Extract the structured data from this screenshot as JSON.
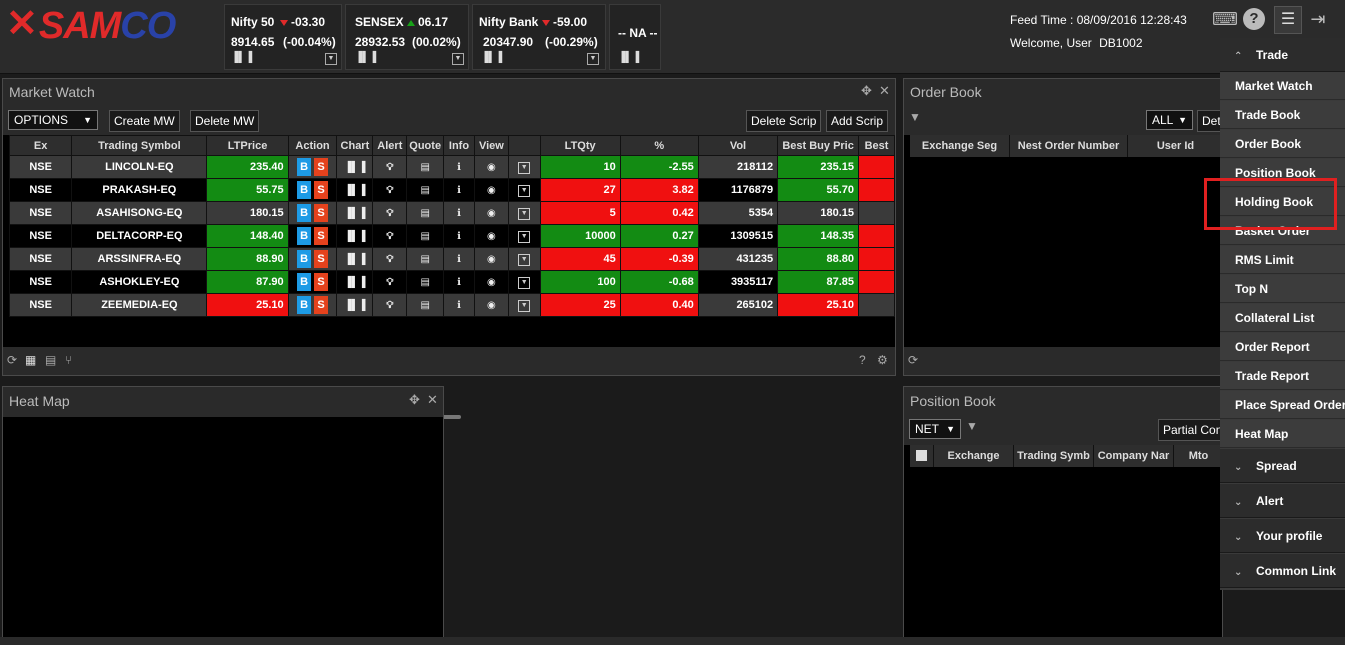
{
  "logo": {
    "mark": "✕",
    "part1": "SAM",
    "part2": "CO"
  },
  "indices": [
    {
      "name": "Nifty 50",
      "change": "-03.30",
      "direction": "down",
      "value": "8914.65",
      "percent": "(-00.04%)"
    },
    {
      "name": "SENSEX",
      "change": "06.17",
      "direction": "up",
      "value": "28932.53",
      "percent": "(00.02%)"
    },
    {
      "name": "Nifty Bank",
      "change": "-59.00",
      "direction": "down",
      "value": "20347.90",
      "percent": "(-00.29%)"
    },
    {
      "name": "-- NA --"
    }
  ],
  "header": {
    "feed_label": "Feed Time :",
    "feed_time": "08/09/2016 12:28:43",
    "welcome_label": "Welcome, User",
    "user_id": "DB1002"
  },
  "market_watch": {
    "title": "Market Watch",
    "options_select": "OPTIONS",
    "create_label": "Create MW",
    "delete_label": "Delete MW",
    "delete_scrip_label": "Delete Scrip",
    "add_scrip_label": "Add Scrip",
    "columns": [
      "Ex",
      "Trading Symbol",
      "LTPrice",
      "Action",
      "Chart",
      "Alert",
      "Quote",
      "Info",
      "View",
      "",
      "LTQty",
      "%",
      "Vol",
      "Best Buy Pric",
      "Best"
    ],
    "buy_label": "B",
    "sell_label": "S",
    "rows": [
      {
        "ex": "NSE",
        "symbol": "LINCOLN-EQ",
        "ltp": "235.40",
        "ltp_color": "green",
        "ltqty": "10",
        "pct": "-2.55",
        "pct_color": "green",
        "vol": "218112",
        "bbp": "235.15",
        "best_color": "red"
      },
      {
        "ex": "NSE",
        "symbol": "PRAKASH-EQ",
        "ltp": "55.75",
        "ltp_color": "green",
        "ltqty": "27",
        "pct": "3.82",
        "pct_color": "red",
        "vol": "1176879",
        "bbp": "55.70",
        "best_color": "red"
      },
      {
        "ex": "NSE",
        "symbol": "ASAHISONG-EQ",
        "ltp": "180.15",
        "ltp_color": "none",
        "ltqty": "5",
        "pct": "0.42",
        "pct_color": "red",
        "vol": "5354",
        "bbp": "180.15",
        "best_color": "none"
      },
      {
        "ex": "NSE",
        "symbol": "DELTACORP-EQ",
        "ltp": "148.40",
        "ltp_color": "green",
        "ltqty": "10000",
        "pct": "0.27",
        "pct_color": "green",
        "vol": "1309515",
        "bbp": "148.35",
        "best_color": "red"
      },
      {
        "ex": "NSE",
        "symbol": "ARSSINFRA-EQ",
        "ltp": "88.90",
        "ltp_color": "green",
        "ltqty": "45",
        "pct": "-0.39",
        "pct_color": "red",
        "vol": "431235",
        "bbp": "88.80",
        "best_color": "red"
      },
      {
        "ex": "NSE",
        "symbol": "ASHOKLEY-EQ",
        "ltp": "87.90",
        "ltp_color": "green",
        "ltqty": "100",
        "pct": "-0.68",
        "pct_color": "green",
        "vol": "3935117",
        "bbp": "87.85",
        "best_color": "red"
      },
      {
        "ex": "NSE",
        "symbol": "ZEEMEDIA-EQ",
        "ltp": "25.10",
        "ltp_color": "red",
        "ltqty": "25",
        "pct": "0.40",
        "pct_color": "red",
        "vol": "265102",
        "bbp": "25.10",
        "best_color": "none"
      }
    ]
  },
  "order_book": {
    "title": "Order Book",
    "filter_select": "ALL",
    "partial_button": "Det",
    "columns": [
      "Exchange Seg",
      "Nest Order Number",
      "User Id"
    ]
  },
  "heat_map": {
    "title": "Heat Map"
  },
  "position_book": {
    "title": "Position Book",
    "net_select": "NET",
    "partial_button": "Partial Con",
    "columns": [
      "Exchange",
      "Trading Symb",
      "Company Nar",
      "Mto"
    ]
  },
  "menu": {
    "trade_section": "Trade",
    "items": [
      "Market Watch",
      "Trade Book",
      "Order Book",
      "Position Book",
      "Holding Book",
      "Basket Order",
      "RMS Limit",
      "Top N",
      "Collateral List",
      "Order Report",
      "Trade Report",
      "Place Spread Order",
      "Heat Map"
    ],
    "sections": [
      "Spread",
      "Alert",
      "Your profile",
      "Common Link"
    ],
    "highlighted": "Holding Book",
    "accent": "#e02020"
  }
}
